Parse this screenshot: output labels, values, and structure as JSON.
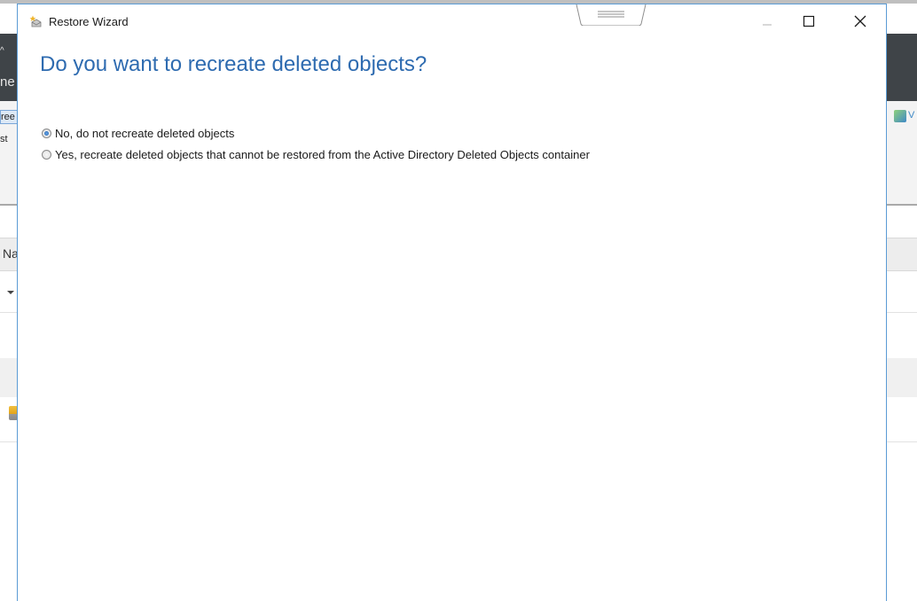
{
  "window": {
    "title": "Restore Wizard"
  },
  "page": {
    "heading": "Do you want to recreate deleted objects?"
  },
  "options": [
    {
      "label": "No, do not recreate deleted objects",
      "selected": true
    },
    {
      "label": "Yes, recreate deleted objects that cannot be restored from the Active Directory Deleted Objects container",
      "selected": false
    }
  ],
  "background": {
    "dark_header_fragment": "ne",
    "ribbon_fragment_1": "ree",
    "ribbon_fragment_2": "st",
    "ribbon_right_fragment": "V",
    "column_header_fragment": "Na"
  },
  "colors": {
    "heading": "#2e6bb0",
    "dialog_border": "#5b9bd5",
    "background_header": "#3f4448"
  },
  "icons": {
    "app": "restore-wizard-icon",
    "minimize": "minimize-icon",
    "maximize": "maximize-icon",
    "close": "close-icon"
  }
}
